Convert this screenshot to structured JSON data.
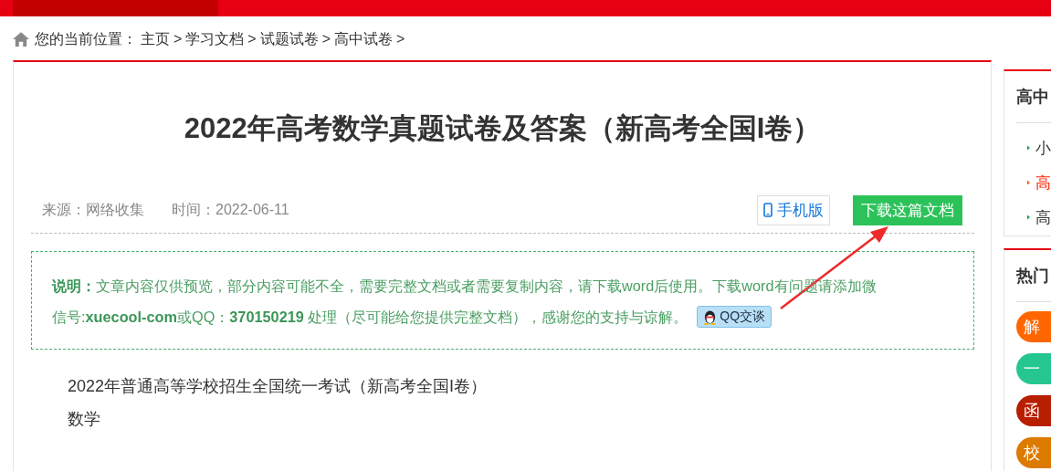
{
  "breadcrumb": {
    "label": "您的当前位置：",
    "items": [
      {
        "label": "主页",
        "separator": ">"
      },
      {
        "label": "学习文档",
        "separator": ">"
      },
      {
        "label": "试题试卷",
        "separator": ">"
      },
      {
        "label": "高中试卷",
        "separator": ">"
      }
    ]
  },
  "article": {
    "title": "2022年高考数学真题试卷及答案（新高考全国I卷）",
    "source": "来源：网络收集",
    "time": "时间：2022-06-11",
    "mobile_button": "手机版",
    "download_button": "下载这篇文档",
    "notice": [
      "**说明：**文章内容仅供预览，部分内容可能不全，需要完整文档或者需要复制内容，请下载word后使用。下载word有问题请添加微",
      "信号:**xuecool-com**或QQ：**370150219** 处理（尽可能给您提供完整文档），感谢您的支持与谅解。"
    ],
    "qq_button": "QQ交谈",
    "body": [
      "2022年普通高等学校招生全国统一考试（新高考全国I卷）",
      "数学"
    ]
  },
  "sidebar": [
    {
      "title": "高中",
      "kind": "list",
      "items": [
        {
          "label": "小",
          "selected": false
        },
        {
          "label": "高",
          "selected": true
        },
        {
          "label": "高",
          "selected": false
        }
      ]
    },
    {
      "title": "热门",
      "kind": "tags",
      "items": [
        {
          "label": "解",
          "color": "#ff6600"
        },
        {
          "label": "一",
          "color": "#26c690"
        },
        {
          "label": "函",
          "color": "#b81e00"
        },
        {
          "label": "校",
          "color": "#dd7a00"
        }
      ]
    }
  ]
}
